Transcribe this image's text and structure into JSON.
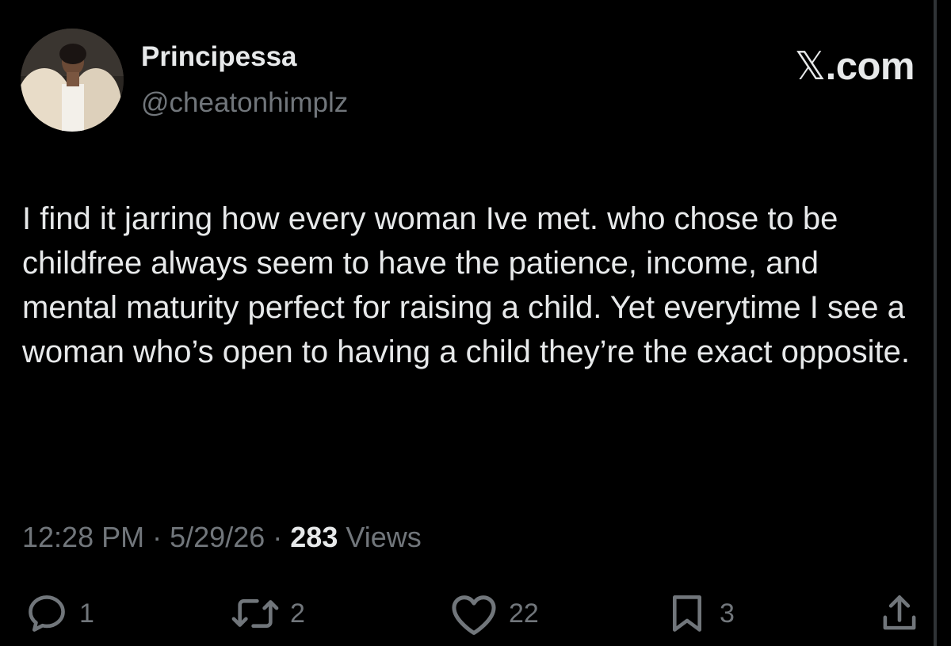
{
  "user": {
    "display_name": "Principessa",
    "handle": "@cheatonhimplz"
  },
  "brand": {
    "glyph": "𝕏",
    "suffix": ".com"
  },
  "tweet": {
    "text": "I find it jarring how every woman Ive met. who chose to be childfree always seem to have the patience, income, and mental maturity perfect for raising a child. Yet everytime I see a woman who’s open to having a child they’re the exact opposite."
  },
  "meta": {
    "time": "12:28 PM",
    "separator": "·",
    "date": "5/29/26",
    "views_count": "283",
    "views_label": "Views"
  },
  "actions": {
    "replies": "1",
    "reposts": "2",
    "likes": "22",
    "bookmarks": "3"
  },
  "icons": {
    "reply": "reply-icon",
    "repost": "repost-icon",
    "like": "heart-icon",
    "bookmark": "bookmark-icon",
    "share": "share-icon"
  },
  "colors": {
    "background": "#000000",
    "primary_text": "#e7e9ea",
    "secondary_text": "#71767b"
  }
}
